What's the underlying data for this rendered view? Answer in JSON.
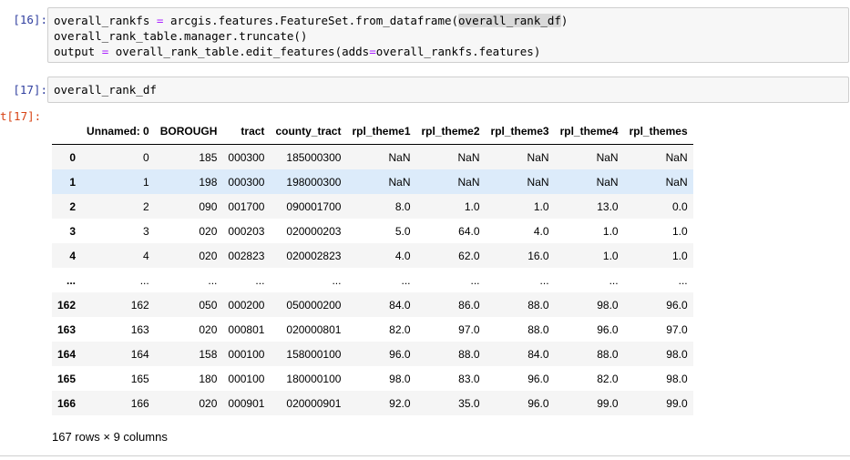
{
  "cells": [
    {
      "prompt": "[16]:",
      "lines": [
        [
          "overall_rankfs ",
          "=",
          " arcgis.features.FeatureSet.from_dataframe(",
          "overall_rank_df",
          ")"
        ],
        [
          "overall_rank_table.manager.truncate()"
        ],
        [
          "output ",
          "=",
          " overall_rank_table.edit_features(adds",
          "=",
          "overall_rankfs.features)"
        ]
      ]
    },
    {
      "prompt": "[17]:",
      "code": "overall_rank_df"
    }
  ],
  "output_prompt": "t[17]:",
  "table": {
    "columns": [
      "",
      "Unnamed: 0",
      "BOROUGH",
      "tract",
      "county_tract",
      "rpl_theme1",
      "rpl_theme2",
      "rpl_theme3",
      "rpl_theme4",
      "rpl_themes"
    ],
    "rows": [
      [
        "0",
        "0",
        "185",
        "000300",
        "185000300",
        "NaN",
        "NaN",
        "NaN",
        "NaN",
        "NaN"
      ],
      [
        "1",
        "1",
        "198",
        "000300",
        "198000300",
        "NaN",
        "NaN",
        "NaN",
        "NaN",
        "NaN"
      ],
      [
        "2",
        "2",
        "090",
        "001700",
        "090001700",
        "8.0",
        "1.0",
        "1.0",
        "13.0",
        "0.0"
      ],
      [
        "3",
        "3",
        "020",
        "000203",
        "020000203",
        "5.0",
        "64.0",
        "4.0",
        "1.0",
        "1.0"
      ],
      [
        "4",
        "4",
        "020",
        "002823",
        "020002823",
        "4.0",
        "62.0",
        "16.0",
        "1.0",
        "1.0"
      ],
      [
        "...",
        "...",
        "...",
        "...",
        "...",
        "...",
        "...",
        "...",
        "...",
        "..."
      ],
      [
        "162",
        "162",
        "050",
        "000200",
        "050000200",
        "84.0",
        "86.0",
        "88.0",
        "98.0",
        "96.0"
      ],
      [
        "163",
        "163",
        "020",
        "000801",
        "020000801",
        "82.0",
        "97.0",
        "88.0",
        "96.0",
        "97.0"
      ],
      [
        "164",
        "164",
        "158",
        "000100",
        "158000100",
        "96.0",
        "88.0",
        "84.0",
        "88.0",
        "98.0"
      ],
      [
        "165",
        "165",
        "180",
        "000100",
        "180000100",
        "98.0",
        "83.0",
        "96.0",
        "82.0",
        "98.0"
      ],
      [
        "166",
        "166",
        "020",
        "000901",
        "020000901",
        "92.0",
        "35.0",
        "96.0",
        "99.0",
        "99.0"
      ]
    ],
    "hover_row": 1,
    "shape_note": "167 rows × 9 columns"
  },
  "colors": {
    "prompt_in": "#303f9f",
    "prompt_out": "#d84315",
    "operator": "#aa22ff",
    "hover_row": "#dcebfa",
    "input_bg": "#f7f7f7"
  }
}
